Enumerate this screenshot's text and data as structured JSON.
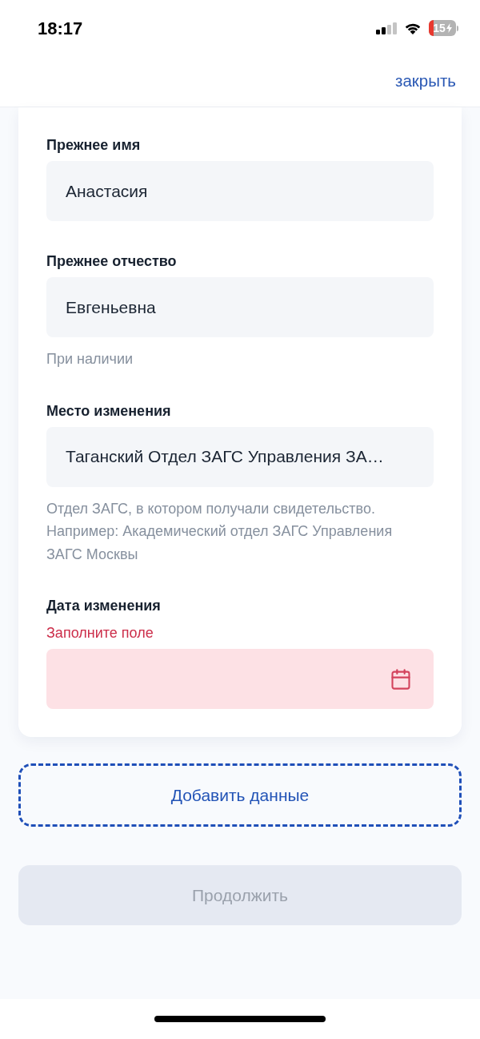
{
  "status_bar": {
    "time": "18:17",
    "battery": "15"
  },
  "header": {
    "close_link": "закрыть"
  },
  "form": {
    "fields": [
      {
        "kind": "text",
        "label": "Прежнее имя",
        "value": "Анастасия",
        "invalid": false
      },
      {
        "kind": "text",
        "label": "Прежнее отчество",
        "value": "Евгеньевна",
        "invalid": false,
        "hint": "При наличии"
      },
      {
        "kind": "text",
        "label": "Место изменения",
        "value": "Таганский Отдел ЗАГС Управления ЗА…",
        "invalid": false,
        "hint": "Отдел ЗАГС, в котором получали свидетельство. Например: Академический отдел ЗАГС Управления ЗАГС Москвы"
      },
      {
        "kind": "date",
        "label": "Дата изменения",
        "error": "Заполните поле",
        "invalid": true
      }
    ]
  },
  "add_button": {
    "label": "Добавить данные"
  },
  "continue_button": {
    "label": "Продолжить",
    "disabled": true
  }
}
